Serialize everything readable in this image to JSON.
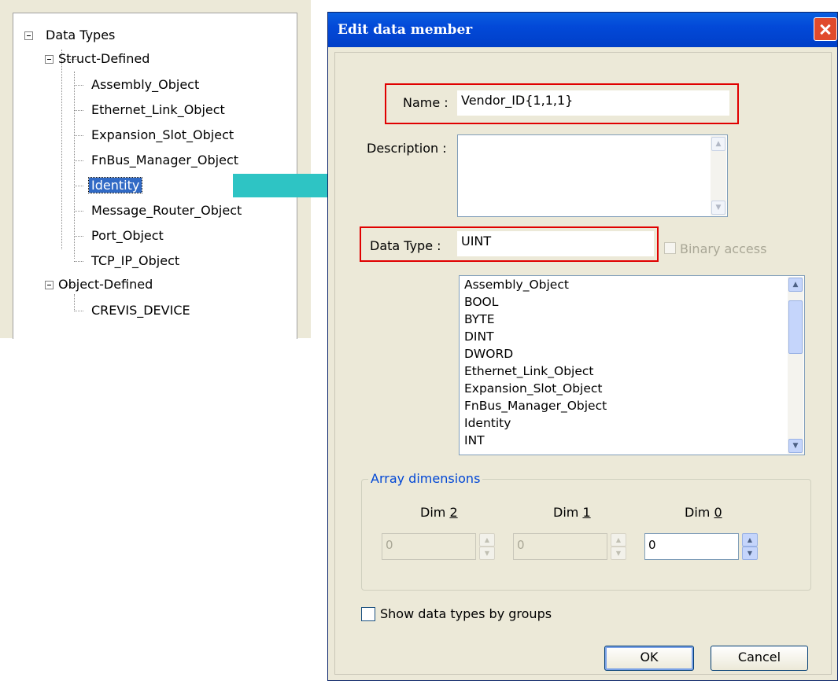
{
  "tree": {
    "root": {
      "label": "Data Types"
    },
    "groups": [
      {
        "label": "Struct-Defined",
        "items": [
          "Assembly_Object",
          "Ethernet_Link_Object",
          "Expansion_Slot_Object",
          "FnBus_Manager_Object",
          "Identity",
          "Message_Router_Object",
          "Port_Object",
          "TCP_IP_Object"
        ]
      },
      {
        "label": "Object-Defined",
        "items": [
          "CREVIS_DEVICE"
        ]
      }
    ],
    "selected_item": "Identity"
  },
  "dialog": {
    "title": "Edit data member",
    "name_label": "Name :",
    "name_value": "Vendor_ID{1,1,1}",
    "description_label": "Description :",
    "description_value": "",
    "datatype_label": "Data Type :",
    "datatype_value": "UINT",
    "binary_access_label": "Binary access",
    "type_list": [
      "Assembly_Object",
      "BOOL",
      "BYTE",
      "DINT",
      "DWORD",
      "Ethernet_Link_Object",
      "Expansion_Slot_Object",
      "FnBus_Manager_Object",
      "Identity",
      "INT"
    ],
    "array_dimensions": {
      "title": "Array dimensions",
      "dim2": {
        "label_prefix": "Dim ",
        "label_key": "2",
        "value": "0"
      },
      "dim1": {
        "label_prefix": "Dim ",
        "label_key": "1",
        "value": "0"
      },
      "dim0": {
        "label_prefix": "Dim ",
        "label_key": "0",
        "value": "0"
      }
    },
    "show_groups_label": "Show data types by groups",
    "ok_label": "OK",
    "cancel_label": "Cancel"
  },
  "colors": {
    "highlight_box": "#e00000",
    "arrow": "#2ec4c4",
    "selection": "#316ac5",
    "titlebar": "#0349d8"
  }
}
